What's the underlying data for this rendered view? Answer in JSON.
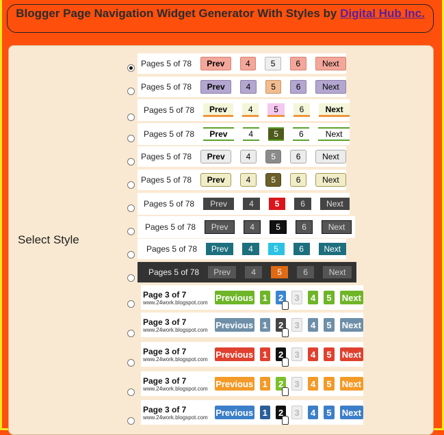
{
  "title": {
    "text_before_link": "Blogger Page Navigation Widget Generator With Styles by ",
    "link_text": "Digital Hub Inc."
  },
  "select_label": "Select Style",
  "page_label_a": "Pages 5 of 78",
  "prev_a": "Prev",
  "next_a": "Next",
  "nums_a": [
    "4",
    "5",
    "6"
  ],
  "page_label_b": "Page 3 of 7",
  "url_b": "www.24work.blogspot.com",
  "prev_b": "Previous",
  "next_b": "Next",
  "nums_b": [
    "1",
    "2",
    "3",
    "4",
    "5"
  ],
  "selected_style": 1
}
